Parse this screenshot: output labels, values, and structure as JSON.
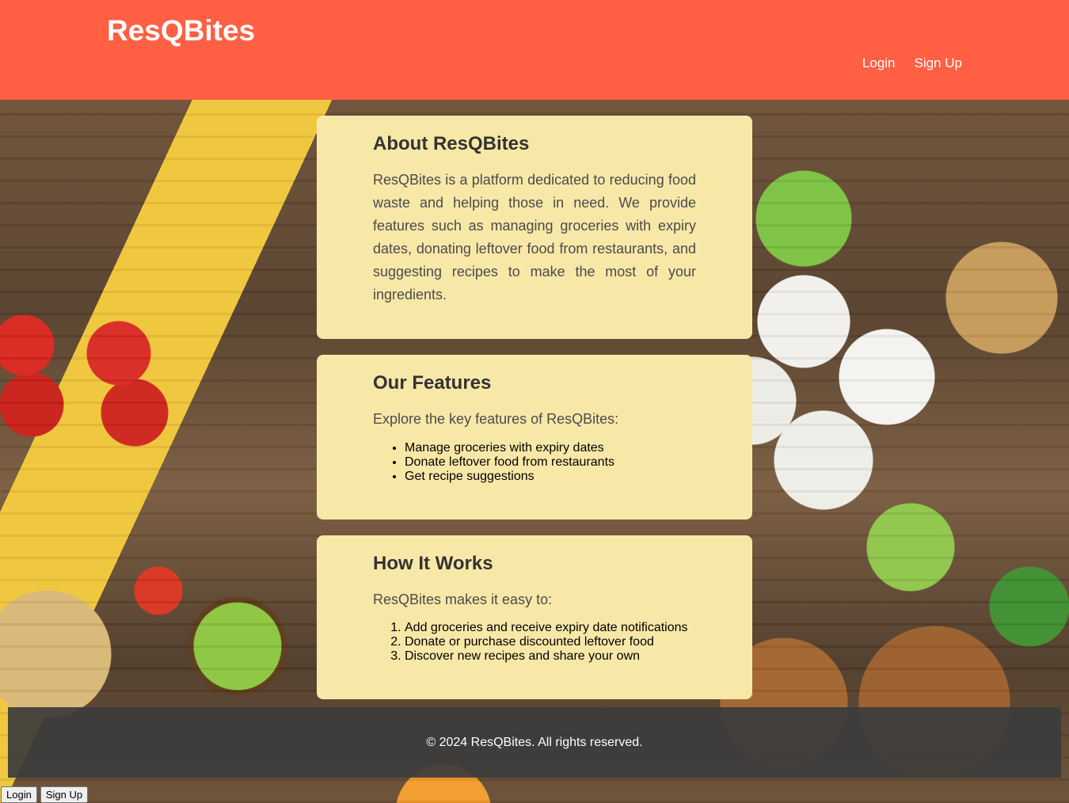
{
  "header": {
    "brand": "ResQBites",
    "nav": {
      "login": "Login",
      "signup": "Sign Up"
    },
    "background_color": "#ff5f43"
  },
  "about": {
    "title": "About ResQBites",
    "text": "ResQBites is a platform dedicated to reducing food waste and helping those in need. We provide features such as managing groceries with expiry dates, donating leftover food from restaurants, and suggesting recipes to make the most of your ingredients."
  },
  "features": {
    "title": "Our Features",
    "intro": "Explore the key features of ResQBites:",
    "items": [
      "Manage groceries with expiry dates",
      "Donate leftover food from restaurants",
      "Get recipe suggestions"
    ]
  },
  "how": {
    "title": "How It Works",
    "intro": "ResQBites makes it easy to:",
    "steps": [
      "Add groceries and receive expiry date notifications",
      "Donate or purchase discounted leftover food",
      "Discover new recipes and share your own"
    ]
  },
  "footer": {
    "copyright": "© 2024 ResQBites. All rights reserved."
  },
  "bottom_buttons": {
    "login": "Login",
    "signup": "Sign Up"
  },
  "colors": {
    "card_background": "#f8e8a8",
    "footer_background": "#3c3c3c"
  }
}
